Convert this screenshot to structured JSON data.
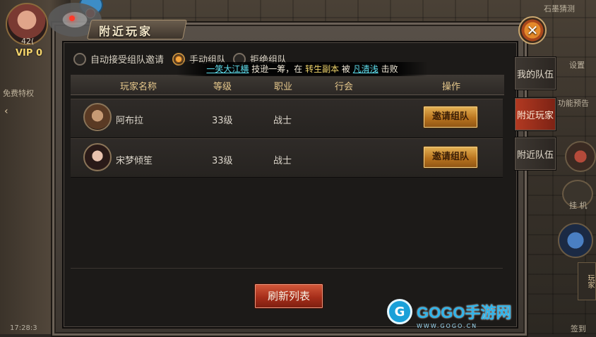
{
  "hud": {
    "level_text": "42(",
    "vip_text": "VIP 0",
    "free_privilege": "免费特权",
    "stone_guess": "石墨猜测",
    "settings": "设置",
    "feature_preview": "功能预告",
    "hangup": "挂 机",
    "side_player": "玩家",
    "check_in": "签到",
    "time": "17:28:3"
  },
  "panel": {
    "title": "附近玩家",
    "close_glyph": "✕",
    "options": [
      {
        "label": "自动接受组队邀请",
        "selected": false
      },
      {
        "label": "手动组队",
        "selected": true
      },
      {
        "label": "拒绝组队",
        "selected": false
      }
    ],
    "banner": {
      "player1": "一笑大江横",
      "text1": " 技逊一筹，在 ",
      "mode": "转生副本",
      "text2": " 被 ",
      "player2": "凡清浅",
      "text3": " 击败"
    },
    "columns": [
      "玩家名称",
      "等级",
      "职业",
      "行会",
      "操作"
    ],
    "rows": [
      {
        "name": "阿布拉",
        "level": "33级",
        "job": "战士",
        "guild": "",
        "action": "邀请组队"
      },
      {
        "name": "宋梦倾笙",
        "level": "33级",
        "job": "战士",
        "guild": "",
        "action": "邀请组队"
      }
    ],
    "refresh_label": "刷新列表"
  },
  "tabs": [
    {
      "label": "我的队伍",
      "active": false
    },
    {
      "label": "附近玩家",
      "active": true
    },
    {
      "label": "附近队伍",
      "active": false
    }
  ],
  "watermark": {
    "logo": "G",
    "text": "GOGO手游网",
    "sub": "WWW.GOGO.CN"
  },
  "colors": {
    "accent_gold": "#e7c98d",
    "invite_button": "#c98a2c",
    "refresh_button": "#a62e1a",
    "active_tab": "#b33a22",
    "banner_player": "#5fe0ef",
    "banner_mode": "#f1d56b"
  }
}
